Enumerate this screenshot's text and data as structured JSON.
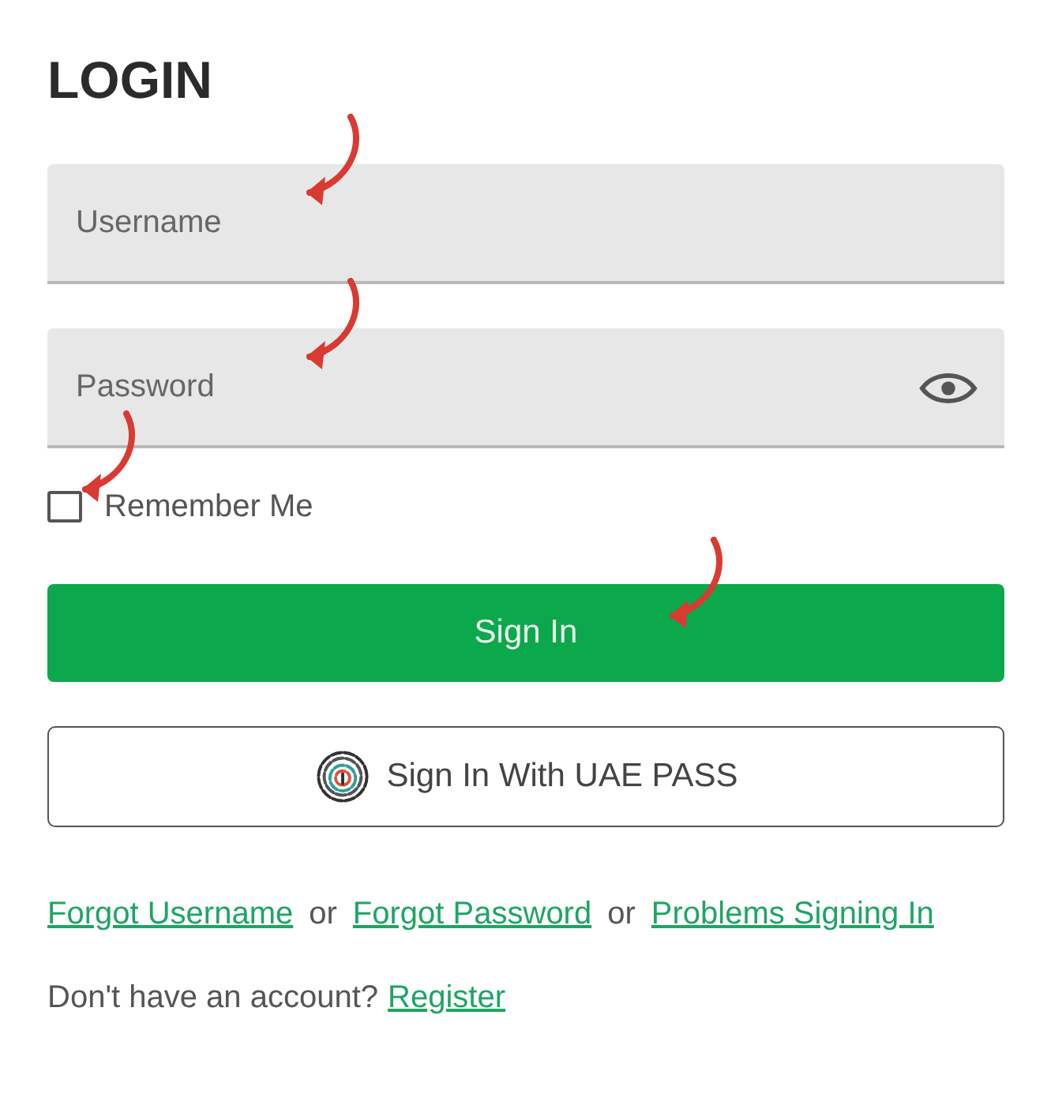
{
  "title": "LOGIN",
  "username": {
    "placeholder": "Username"
  },
  "password": {
    "placeholder": "Password"
  },
  "remember": {
    "label": "Remember Me",
    "checked": false
  },
  "sign_in_button": "Sign In",
  "uae_pass_button": "Sign In With UAE PASS",
  "help_links": [
    {
      "kind": "link",
      "text": "Forgot Username"
    },
    {
      "kind": "text",
      "text": "or"
    },
    {
      "kind": "link",
      "text": "Forgot Password"
    },
    {
      "kind": "text",
      "text": "or"
    },
    {
      "kind": "link",
      "text": "Problems Signing In"
    }
  ],
  "register": {
    "prompt": "Don't have an account?",
    "link": "Register"
  }
}
